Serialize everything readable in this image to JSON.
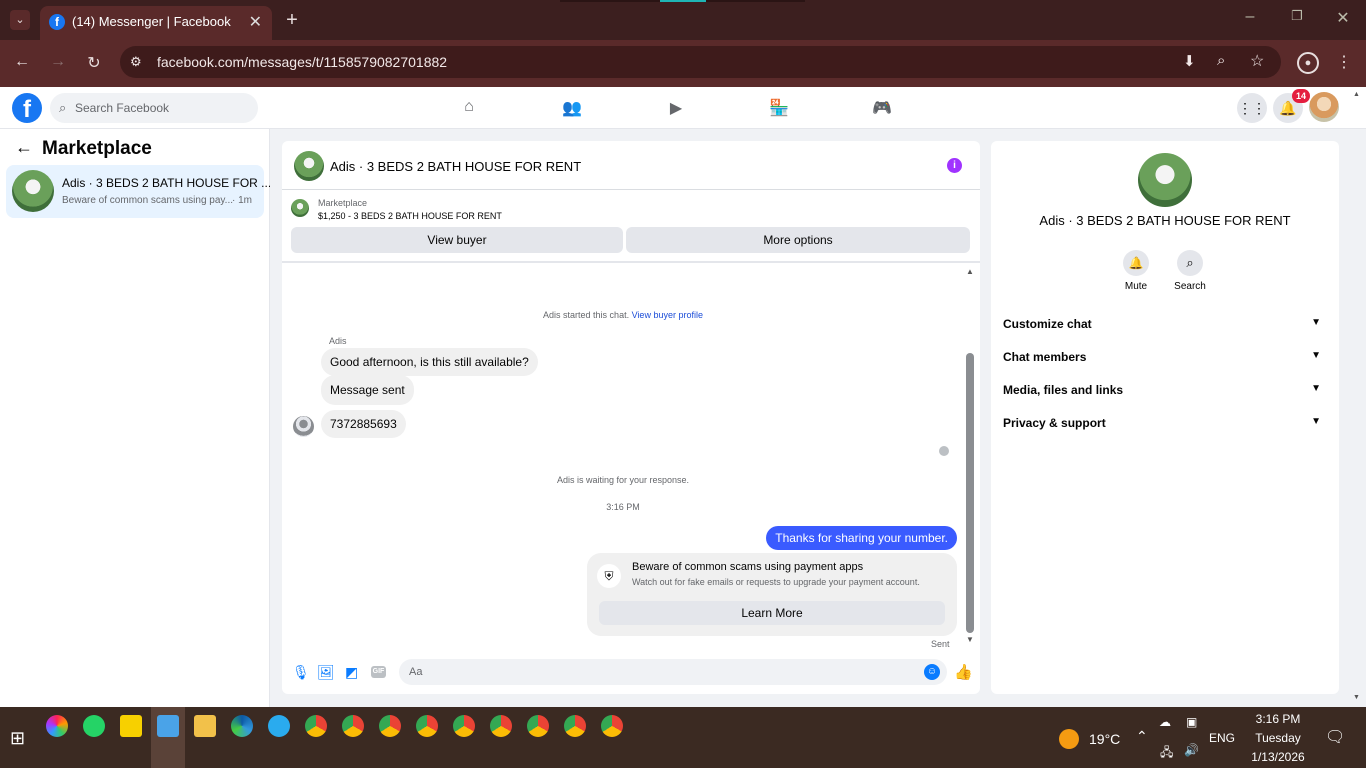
{
  "browser": {
    "tab_title": "(14) Messenger | Facebook",
    "url": "facebook.com/messages/t/1158579082701882"
  },
  "fb": {
    "search_placeholder": "Search Facebook",
    "notifications_count": "14"
  },
  "sidebar": {
    "title": "Marketplace",
    "thread": {
      "name": "Adis · 3 BEDS 2 BATH HOUSE FOR ...",
      "preview": "Beware of common scams using pay...",
      "time": "· 1m"
    }
  },
  "chat": {
    "title": "Adis · 3 BEDS 2 BATH HOUSE FOR RENT",
    "listing_label": "Marketplace",
    "listing_detail": "$1,250 - 3 BEDS 2 BATH HOUSE FOR RENT",
    "view_buyer": "View buyer",
    "more_options": "More options",
    "started_text": "Adis started this chat.",
    "view_buyer_profile": "View buyer profile",
    "sender_name": "Adis",
    "messages_in": [
      "Good afternoon, is this still available?",
      "Message sent",
      "7372885693"
    ],
    "waiting_text": "Adis is waiting for your response.",
    "timestamp": "3:16 PM",
    "message_out": "Thanks for sharing your number.",
    "scam_title": "Beware of common scams using payment apps",
    "scam_body": "Watch out for fake emails or requests to upgrade your payment account.",
    "learn_more": "Learn More",
    "sent_status": "Sent",
    "composer_placeholder": "Aa"
  },
  "right_panel": {
    "name": "Adis · 3 BEDS 2 BATH HOUSE FOR RENT",
    "mute": "Mute",
    "search": "Search",
    "sections": [
      "Customize chat",
      "Chat members",
      "Media, files and links",
      "Privacy & support"
    ]
  },
  "taskbar": {
    "temperature": "19°C",
    "language": "ENG",
    "time": "3:16 PM",
    "day": "Tuesday",
    "date": "1/13/2026"
  },
  "colors": {
    "accent": "#0a7cff",
    "out_bubble": "#3a5bff",
    "brand": "#1877f2",
    "info": "#a033ff"
  }
}
